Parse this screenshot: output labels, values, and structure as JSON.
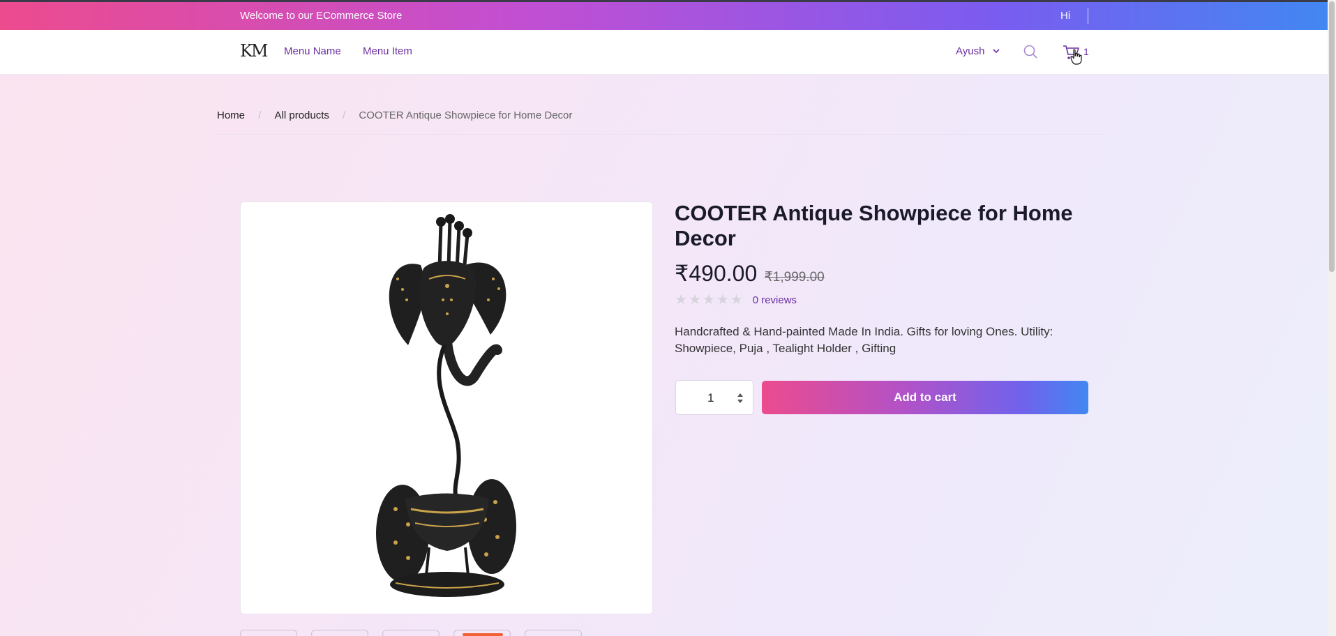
{
  "promo": {
    "welcome": "Welcome to our ECommerce Store",
    "greeting": "Hi"
  },
  "header": {
    "logo": "KM",
    "nav": [
      "Menu Name",
      "Menu Item"
    ],
    "user_name": "Ayush",
    "cart_count": "1",
    "icons": {
      "search": "search-icon",
      "cart": "cart-icon",
      "dropdown": "chevron-down-icon"
    }
  },
  "breadcrumb": [
    "Home",
    "All products",
    "COOTER Antique Showpiece for Home Decor"
  ],
  "product": {
    "title": "COOTER Antique Showpiece for Home Decor",
    "price": "₹490.00",
    "mrp": "₹1,999.00",
    "rating": 0,
    "max_rating": 5,
    "reviews": "0 reviews",
    "description": "Handcrafted & Hand-painted Made In India. Gifts for loving Ones. Utility: Showpiece, Puja , Tealight Holder , Gifting",
    "quantity": "1",
    "add_to_cart": "Add to cart",
    "thumbnails_count": 5,
    "active_thumbnail": 4
  },
  "colors": {
    "accent": "#6b2fa3",
    "gradient_start": "#ec4b8e",
    "gradient_end": "#4287f2",
    "thumb_active": "#f06235"
  }
}
